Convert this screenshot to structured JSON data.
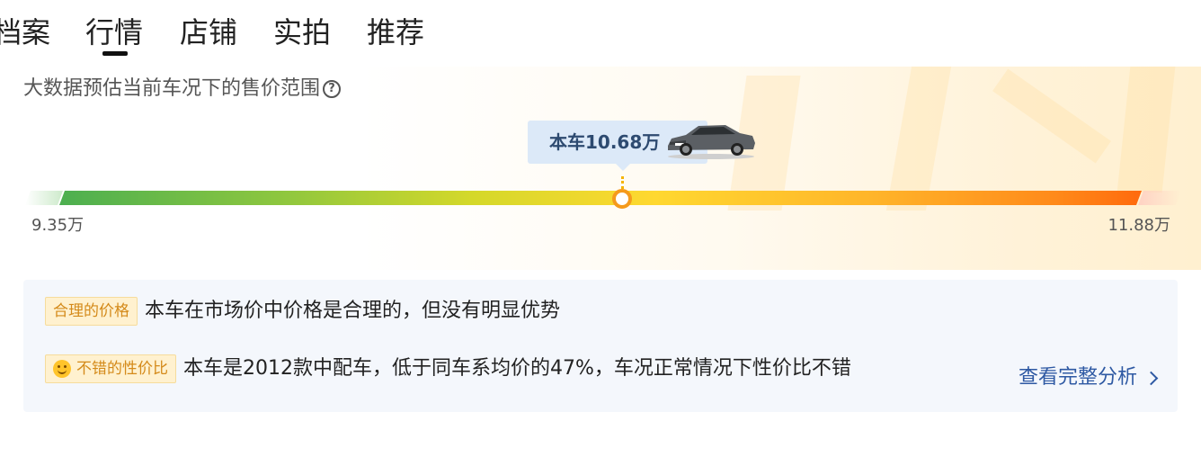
{
  "tabs": [
    {
      "label": "档案",
      "active": false
    },
    {
      "label": "行情",
      "active": true
    },
    {
      "label": "店铺",
      "active": false
    },
    {
      "label": "实拍",
      "active": false
    },
    {
      "label": "推荐",
      "active": false
    }
  ],
  "valuation": {
    "title": "大数据预估当前车况下的售价范围",
    "help_icon": "question-circle-icon",
    "current_price_label": "本车10.68万",
    "range_low": "9.35万",
    "range_high": "11.88万",
    "current_price_value": 10.68,
    "range_low_value": 9.35,
    "range_high_value": 11.88,
    "car_image": "sedan-car-image"
  },
  "analysis": {
    "items": [
      {
        "badge": "合理的价格",
        "icon": null,
        "text": "本车在市场价中价格是合理的，但没有明显优势"
      },
      {
        "badge": "不错的性价比",
        "icon": "smile-icon",
        "text": "本车是2012款中配车，低于同车系均价的47%，车况正常情况下性价比不错"
      }
    ],
    "link_label": "查看完整分析"
  },
  "colors": {
    "accent_link": "#2e59a3",
    "badge_bg": "#fff1cf",
    "badge_text": "#d48a1a",
    "price_bubble_bg": "#dce9f8",
    "marker": "#f59a1c"
  }
}
